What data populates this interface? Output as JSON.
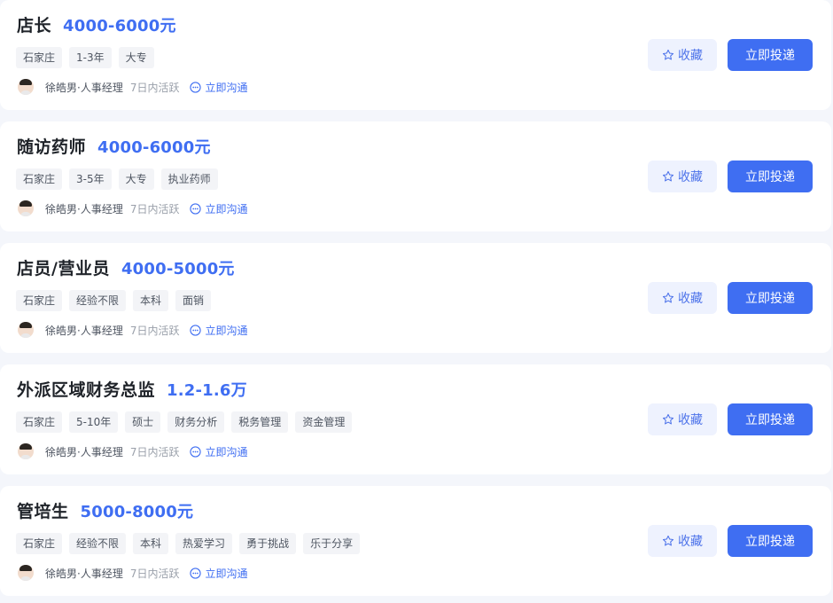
{
  "jobs": [
    {
      "title": "店长",
      "salary": "4000-6000元",
      "tags": [
        "石家庄",
        "1-3年",
        "大专"
      ],
      "recruiter": "徐皓男·人事经理",
      "active": "7日内活跃",
      "chat_label": "立即沟通",
      "fav_label": "收藏",
      "apply_label": "立即投递"
    },
    {
      "title": "随访药师",
      "salary": "4000-6000元",
      "tags": [
        "石家庄",
        "3-5年",
        "大专",
        "执业药师"
      ],
      "recruiter": "徐皓男·人事经理",
      "active": "7日内活跃",
      "chat_label": "立即沟通",
      "fav_label": "收藏",
      "apply_label": "立即投递"
    },
    {
      "title": "店员/营业员",
      "salary": "4000-5000元",
      "tags": [
        "石家庄",
        "经验不限",
        "本科",
        "面销"
      ],
      "recruiter": "徐皓男·人事经理",
      "active": "7日内活跃",
      "chat_label": "立即沟通",
      "fav_label": "收藏",
      "apply_label": "立即投递"
    },
    {
      "title": "外派区域财务总监",
      "salary": "1.2-1.6万",
      "tags": [
        "石家庄",
        "5-10年",
        "硕士",
        "财务分析",
        "税务管理",
        "资金管理"
      ],
      "recruiter": "徐皓男·人事经理",
      "active": "7日内活跃",
      "chat_label": "立即沟通",
      "fav_label": "收藏",
      "apply_label": "立即投递"
    },
    {
      "title": "管培生",
      "salary": "5000-8000元",
      "tags": [
        "石家庄",
        "经验不限",
        "本科",
        "热爱学习",
        "勇于挑战",
        "乐于分享"
      ],
      "recruiter": "徐皓男·人事经理",
      "active": "7日内活跃",
      "chat_label": "立即沟通",
      "fav_label": "收藏",
      "apply_label": "立即投递"
    }
  ],
  "icons": {
    "favorite": "star-outline-icon",
    "chat": "chat-bubble-icon",
    "avatar": "recruiter-avatar"
  },
  "colors": {
    "accent": "#3f6ef2",
    "favorite_bg": "#eef2fe",
    "tag_bg": "#f3f4f7",
    "page_bg": "#f4f6fb"
  }
}
